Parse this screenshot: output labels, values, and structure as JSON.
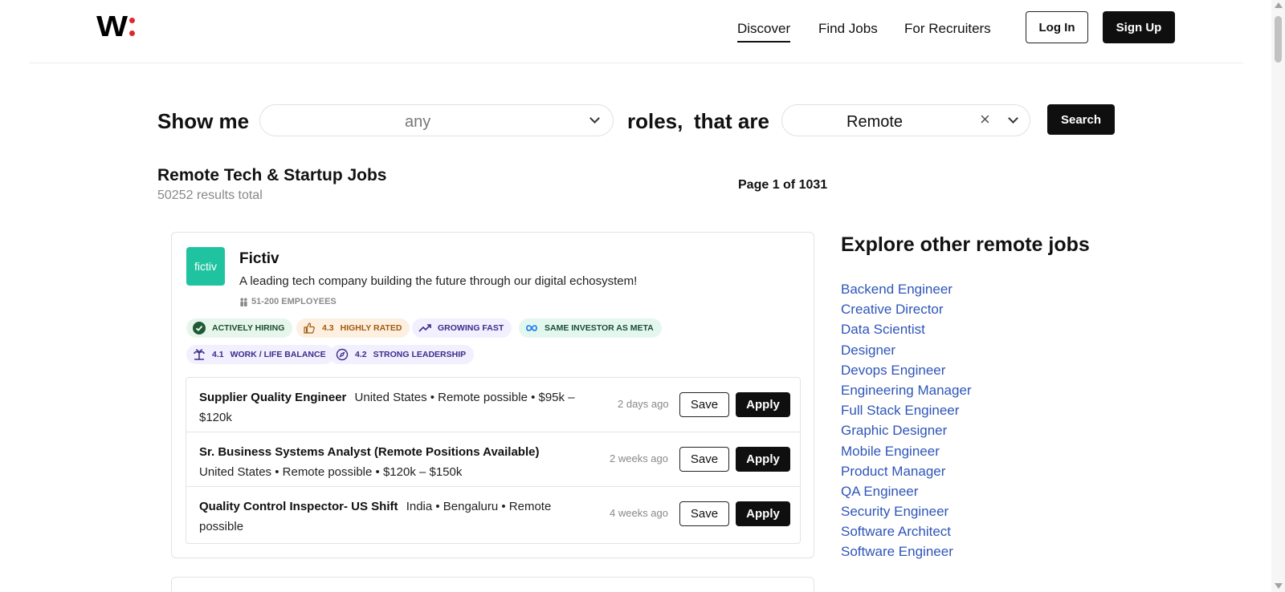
{
  "header": {
    "logo_letter": "W",
    "nav": [
      {
        "label": "Discover",
        "active": true
      },
      {
        "label": "Find Jobs",
        "active": false
      },
      {
        "label": "For Recruiters",
        "active": false
      }
    ],
    "login_label": "Log In",
    "signup_label": "Sign Up"
  },
  "search": {
    "prefix": "Show me",
    "role_value": "any",
    "roles_text": "roles,",
    "that_are_text": "that are",
    "location_value": "Remote",
    "clear_symbol": "×",
    "button_label": "Search"
  },
  "results": {
    "title": "Remote Tech & Startup Jobs",
    "total": "50252 results total",
    "page": "Page 1 of 1031"
  },
  "company": {
    "logo_text": "fictiv",
    "logo_color": "#20c3a0",
    "name": "Fictiv",
    "description": "A leading tech company building the future through our digital echosystem!",
    "size": "51-200 EMPLOYEES",
    "badges": [
      {
        "rating": "",
        "label": "ACTIVELY HIRING",
        "icon": "check-circle-icon"
      },
      {
        "rating": "4.3",
        "label": "HIGHLY RATED",
        "icon": "thumbs-up-icon"
      },
      {
        "rating": "",
        "label": "GROWING FAST",
        "icon": "trending-up-icon"
      },
      {
        "rating": "",
        "label": "SAME INVESTOR AS META",
        "icon": "meta-infinity-icon"
      },
      {
        "rating": "4.1",
        "label": "WORK / LIFE BALANCE",
        "icon": "palm-tree-icon"
      },
      {
        "rating": "4.2",
        "label": "STRONG LEADERSHIP",
        "icon": "compass-icon"
      }
    ],
    "jobs": [
      {
        "title": "Supplier Quality Engineer",
        "details": "United States • Remote possible • $95k – $120k",
        "age": "2 days ago",
        "save": "Save",
        "apply": "Apply"
      },
      {
        "title": "Sr. Business Systems Analyst (Remote Positions Available)",
        "details": "United States • Remote possible • $120k – $150k",
        "age": "2 weeks ago",
        "save": "Save",
        "apply": "Apply"
      },
      {
        "title": "Quality Control Inspector- US Shift",
        "details": "India • Bengaluru • Remote possible",
        "age": "4 weeks ago",
        "save": "Save",
        "apply": "Apply"
      }
    ]
  },
  "sidebar": {
    "title": "Explore other remote jobs",
    "links": [
      "Backend Engineer",
      "Creative Director",
      "Data Scientist",
      "Designer",
      "Devops Engineer",
      "Engineering Manager",
      "Full Stack Engineer",
      "Graphic Designer",
      "Mobile Engineer",
      "Product Manager",
      "QA Engineer",
      "Security Engineer",
      "Software Architect",
      "Software Engineer"
    ]
  },
  "colors": {
    "brand_dot": "#e0282e",
    "link": "#2e55b8",
    "primary_button": "#0f0f0f"
  }
}
